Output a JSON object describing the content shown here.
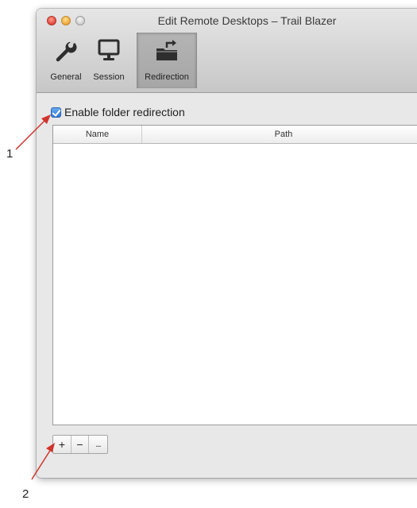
{
  "window": {
    "title": "Edit Remote Desktops – Trail Blazer"
  },
  "toolbar": {
    "items": [
      {
        "label": "General",
        "icon": "wrench-icon"
      },
      {
        "label": "Session",
        "icon": "monitor-icon"
      },
      {
        "label": "Redirection",
        "icon": "folder-redirect-icon",
        "selected": true
      }
    ]
  },
  "redirection": {
    "enable_label": "Enable folder redirection",
    "enabled": true,
    "table": {
      "columns": [
        "Name",
        "Path"
      ],
      "rows": []
    },
    "buttons": {
      "add": "+",
      "remove": "−",
      "more": "..."
    }
  },
  "annotations": [
    "1",
    "2"
  ],
  "colors": {
    "annotation_arrow": "#d0342c",
    "checkbox_accent": "#2f78d6"
  }
}
